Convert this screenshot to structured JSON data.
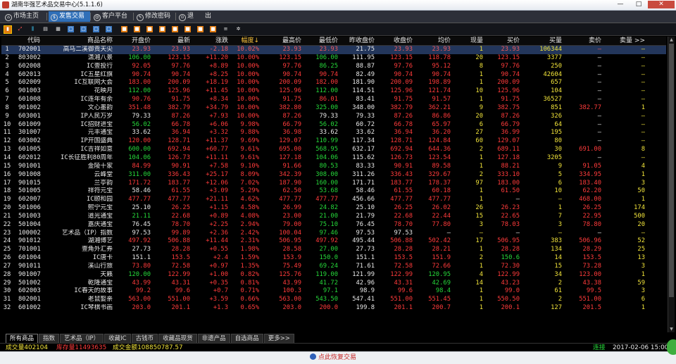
{
  "window": {
    "title": "湖南华强艺术品交易中心(5.1.1.6)",
    "minimize": "—",
    "maximize": "□",
    "close": "✕"
  },
  "nav": [
    {
      "label": "市场主页",
      "icon": "home-icon"
    },
    {
      "label": "发售交易",
      "icon": "trade-icon"
    },
    {
      "label": "客户平台",
      "icon": "client-icon"
    },
    {
      "label": "修改密码",
      "icon": "key-icon"
    },
    {
      "label": "退",
      "icon": "exit-icon"
    },
    {
      "label": "出",
      "icon": ""
    }
  ],
  "table": {
    "headers": [
      "",
      "代码",
      "商品名称",
      "开盘价",
      "最新",
      "涨跌",
      "幅度↓",
      "最高价",
      "最低价",
      "昨收盘价",
      "收盘价",
      "均价",
      "现量",
      "买价",
      "买量",
      "卖价",
      "卖量 >>"
    ],
    "rows": [
      [
        "1",
        "702001",
        "高马二溪御贡天尖",
        "23.93",
        "23.93",
        "-2.18",
        "10.02%",
        "23.93",
        "23.93",
        "21.75",
        "23.93",
        "23.93",
        "1",
        "23.93",
        "106344",
        "—",
        "—"
      ],
      [
        "2",
        "803002",
        "潇湘八景",
        "106.00",
        "123.15",
        "+11.20",
        "10.00%",
        "123.15",
        "106.00",
        "111.95",
        "123.15",
        "118.78",
        "20",
        "123.15",
        "3377",
        "—",
        "—"
      ],
      [
        "3",
        "602008",
        "IC壹投行",
        "92.05",
        "97.76",
        "+8.89",
        "10.00%",
        "97.76",
        "86.25",
        "88.87",
        "97.76",
        "95.12",
        "8",
        "97.76",
        "250",
        "—",
        "—"
      ],
      [
        "4",
        "602013",
        "IC五星红旗",
        "90.74",
        "90.74",
        "+8.25",
        "10.00%",
        "90.74",
        "90.74",
        "82.49",
        "90.74",
        "90.74",
        "1",
        "90.74",
        "42604",
        "—",
        "—"
      ],
      [
        "5",
        "602009",
        "IC互联网大会",
        "183.00",
        "200.09",
        "+18.19",
        "10.00%",
        "200.09",
        "182.00",
        "181.90",
        "200.09",
        "198.89",
        "1",
        "200.09",
        "657",
        "—",
        "—"
      ],
      [
        "6",
        "901003",
        "花映月",
        "112.00",
        "125.96",
        "+11.45",
        "10.00%",
        "125.96",
        "112.00",
        "114.51",
        "125.96",
        "121.74",
        "10",
        "125.96",
        "104",
        "—",
        "—"
      ],
      [
        "7",
        "601008",
        "IC连年有余",
        "90.76",
        "91.75",
        "+8.34",
        "10.00%",
        "91.75",
        "86.01",
        "83.41",
        "91.75",
        "91.57",
        "1",
        "91.75",
        "36527",
        "—",
        "—"
      ],
      [
        "8",
        "901002",
        "文心墨韵",
        "351.48",
        "382.79",
        "+34.79",
        "10.00%",
        "382.80",
        "325.00",
        "348.00",
        "382.79",
        "362.21",
        "9",
        "382.75",
        "851",
        "382.77",
        "1"
      ],
      [
        "9",
        "603001",
        "IP人民万岁",
        "79.33",
        "87.26",
        "+7.93",
        "10.00%",
        "87.26",
        "79.33",
        "79.33",
        "87.26",
        "86.86",
        "20",
        "87.26",
        "326",
        "—",
        "—"
      ],
      [
        "10",
        "601009",
        "IC招财进宝",
        "56.02",
        "66.78",
        "+6.06",
        "9.98%",
        "66.79",
        "56.02",
        "60.72",
        "66.78",
        "65.97",
        "6",
        "66.79",
        "64",
        "—",
        "—"
      ],
      [
        "11",
        "301007",
        "元丰通宝",
        "33.62",
        "36.94",
        "+3.32",
        "9.88%",
        "36.98",
        "33.62",
        "33.62",
        "36.94",
        "36.20",
        "27",
        "36.99",
        "195",
        "—",
        "—"
      ],
      [
        "12",
        "603002",
        "IP开国盛典",
        "120.00",
        "128.71",
        "+11.37",
        "9.69%",
        "129.07",
        "110.99",
        "117.34",
        "128.71",
        "124.84",
        "60",
        "129.07",
        "80",
        "—",
        "—"
      ],
      [
        "13",
        "601005",
        "IC吉祥如意",
        "600.00",
        "692.94",
        "+60.77",
        "9.61%",
        "695.00",
        "568.95",
        "632.17",
        "692.94",
        "644.36",
        "2",
        "689.11",
        "30",
        "691.00",
        "8"
      ],
      [
        "14",
        "602012",
        "IC长征胜利80周年",
        "104.06",
        "126.73",
        "+11.11",
        "9.61%",
        "127.18",
        "104.06",
        "115.62",
        "126.73",
        "123.54",
        "1",
        "127.18",
        "3205",
        "—",
        "—"
      ],
      [
        "15",
        "901001",
        "金陵十家",
        "84.99",
        "90.91",
        "+7.58",
        "9.10%",
        "91.66",
        "80.53",
        "83.33",
        "90.91",
        "89.58",
        "1",
        "88.21",
        "9",
        "91.05",
        "4"
      ],
      [
        "16",
        "901008",
        "云峰堂",
        "311.00",
        "336.43",
        "+25.17",
        "8.09%",
        "342.39",
        "308.00",
        "311.26",
        "336.43",
        "329.67",
        "2",
        "333.10",
        "5",
        "334.95",
        "1"
      ],
      [
        "17",
        "901015",
        "兰亭韵",
        "171.72",
        "183.77",
        "+12.06",
        "7.02%",
        "187.90",
        "160.00",
        "171.71",
        "183.77",
        "178.37",
        "97",
        "183.00",
        "6",
        "183.40",
        "3"
      ],
      [
        "18",
        "501005",
        "祥符元宝",
        "58.46",
        "61.55",
        "+3.09",
        "5.29%",
        "62.50",
        "53.68",
        "58.46",
        "61.55",
        "60.18",
        "1",
        "61.50",
        "10",
        "62.20",
        "50"
      ],
      [
        "19",
        "602007",
        "IC颐和园",
        "477.77",
        "477.77",
        "+21.11",
        "4.62%",
        "477.77",
        "477.77",
        "456.66",
        "477.77",
        "477.77",
        "1",
        "—",
        "—",
        "468.00",
        "1"
      ],
      [
        "20",
        "501006",
        "熙宁元宝",
        "25.10",
        "26.25",
        "+1.15",
        "4.58%",
        "26.99",
        "24.82",
        "25.10",
        "26.25",
        "26.02",
        "26",
        "26.23",
        "1",
        "26.25",
        "174"
      ],
      [
        "21",
        "501003",
        "道光通宝",
        "21.11",
        "22.68",
        "+0.89",
        "4.08%",
        "23.00",
        "21.00",
        "21.79",
        "22.68",
        "22.44",
        "15",
        "22.65",
        "7",
        "22.95",
        "500"
      ],
      [
        "22",
        "501004",
        "嘉庆通宝",
        "76.45",
        "78.70",
        "+2.25",
        "2.94%",
        "79.00",
        "75.10",
        "76.45",
        "78.70",
        "77.80",
        "3",
        "78.03",
        "3",
        "78.80",
        "20"
      ],
      [
        "23",
        "100002",
        "艺术品（IP）指数",
        "97.53",
        "99.89",
        "+2.36",
        "2.42%",
        "100.04",
        "97.46",
        "97.53",
        "97.53",
        "—",
        "—",
        "—",
        "—",
        "—",
        "—"
      ],
      [
        "24",
        "901012",
        "湖湘博艺",
        "497.92",
        "506.88",
        "+11.44",
        "2.31%",
        "506.95",
        "497.92",
        "495.44",
        "506.88",
        "502.42",
        "17",
        "506.95",
        "383",
        "506.96",
        "52"
      ],
      [
        "25",
        "701001",
        "壹角外汇券",
        "27.73",
        "28.28",
        "+0.55",
        "1.98%",
        "28.58",
        "27.00",
        "27.73",
        "28.28",
        "28.21",
        "1",
        "28.28",
        "134",
        "28.29",
        "25"
      ],
      [
        "26",
        "601004",
        "IC唐卡",
        "151.1",
        "153.5",
        "+2.4",
        "1.59%",
        "153.9",
        "150.0",
        "151.1",
        "153.5",
        "151.9",
        "2",
        "150.6",
        "14",
        "153.5",
        "13"
      ],
      [
        "27",
        "901011",
        "溪山行旅",
        "73.80",
        "72.58",
        "+0.97",
        "1.35%",
        "75.49",
        "69.24",
        "71.61",
        "72.58",
        "72.66",
        "1",
        "72.30",
        "15",
        "73.28",
        "3"
      ],
      [
        "28",
        "901007",
        "天籁",
        "120.00",
        "122.99",
        "+1.00",
        "0.82%",
        "125.76",
        "119.00",
        "121.99",
        "122.99",
        "120.95",
        "4",
        "122.99",
        "34",
        "123.00",
        "1"
      ],
      [
        "29",
        "501002",
        "乾隆通宝",
        "43.99",
        "43.31",
        "+0.35",
        "0.81%",
        "43.99",
        "41.72",
        "42.96",
        "43.31",
        "42.69",
        "14",
        "43.23",
        "2",
        "43.38",
        "59"
      ],
      [
        "30",
        "602003",
        "IC春天的故事",
        "99.2",
        "99.6",
        "+0.7",
        "0.71%",
        "100.3",
        "97.1",
        "98.9",
        "99.6",
        "98.4",
        "1",
        "99.0",
        "61",
        "99.5",
        "3"
      ],
      [
        "31",
        "802001",
        "老鼠娶亲",
        "563.00",
        "551.00",
        "+3.59",
        "0.66%",
        "563.00",
        "543.50",
        "547.41",
        "551.00",
        "551.45",
        "1",
        "550.50",
        "2",
        "551.00",
        "6"
      ],
      [
        "32",
        "601002",
        "IC琴棋书画",
        "203.0",
        "201.1",
        "+1.3",
        "0.65%",
        "203.0",
        "200.0",
        "199.8",
        "201.1",
        "200.7",
        "1",
        "200.1",
        "127",
        "201.5",
        "1"
      ]
    ]
  },
  "tabs": [
    "所有商品",
    "指数",
    "艺术品（IP）",
    "收藏IC",
    "古钱币",
    "收藏品现货",
    "非遗产品",
    "自选商品",
    "更多>>"
  ],
  "status": {
    "volume": "成交量402104",
    "inventory": "库存量11493635",
    "amount": "成交金额108850787.57",
    "connection": "连接",
    "datetime": "2017-02-06 15:00"
  },
  "footer": {
    "restore": "点此恢复交易"
  },
  "colors": {
    "up": "#ff3b3b",
    "down": "#26d83a",
    "flat": "#e8e8e8",
    "volume": "#f2e43a",
    "code": "#e8e8e8",
    "selected_row": "#23365b",
    "nav_active": "#2f6fb8"
  }
}
